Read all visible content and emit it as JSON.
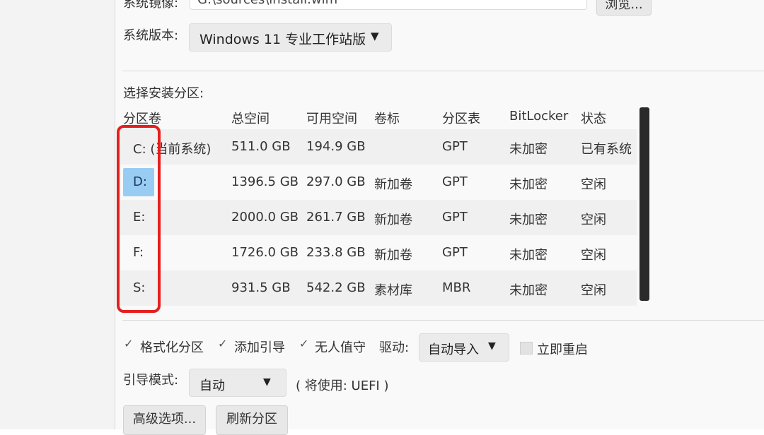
{
  "image_source": {
    "label": "系统镜像:",
    "path": "G:\\sources\\install.wim",
    "browse_button": "浏览..."
  },
  "version": {
    "label": "系统版本:",
    "selected": "Windows 11 专业工作站版",
    "arrow": "▼"
  },
  "partition": {
    "section_label": "选择安装分区:",
    "columns": [
      "分区卷",
      "总空间",
      "可用空间",
      "卷标",
      "分区表",
      "BitLocker",
      "状态"
    ],
    "rows": [
      [
        "C: (当前系统)",
        "511.0 GB",
        "194.9 GB",
        "",
        "GPT",
        "未加密",
        "已有系统"
      ],
      [
        "D:",
        "1396.5 GB",
        "297.0 GB",
        "新加卷",
        "GPT",
        "未加密",
        "空闲"
      ],
      [
        "E:",
        "2000.0 GB",
        "261.7 GB",
        "新加卷",
        "GPT",
        "未加密",
        "空闲"
      ],
      [
        "F:",
        "1726.0 GB",
        "233.8 GB",
        "新加卷",
        "GPT",
        "未加密",
        "空闲"
      ],
      [
        "S:",
        "931.5 GB",
        "542.2 GB",
        "素材库",
        "MBR",
        "未加密",
        "空闲"
      ]
    ],
    "selected_row": 1
  },
  "options": {
    "check_mark": "✓",
    "format": "格式化分区",
    "add_boot": "添加引导",
    "unattended": "无人值守",
    "driver_label": "驱动:",
    "driver_value": "自动导入",
    "restart": "立即重启"
  },
  "boot": {
    "label": "引导模式:",
    "value": "自动",
    "note": "( 将使用: UEFI )"
  },
  "buttons": {
    "advanced": "高级选项...",
    "refresh": "刷新分区"
  },
  "colors": {
    "highlight": "#e61e1e",
    "selection": "#99ccf3",
    "scrollbar": "#2a2a2a"
  }
}
